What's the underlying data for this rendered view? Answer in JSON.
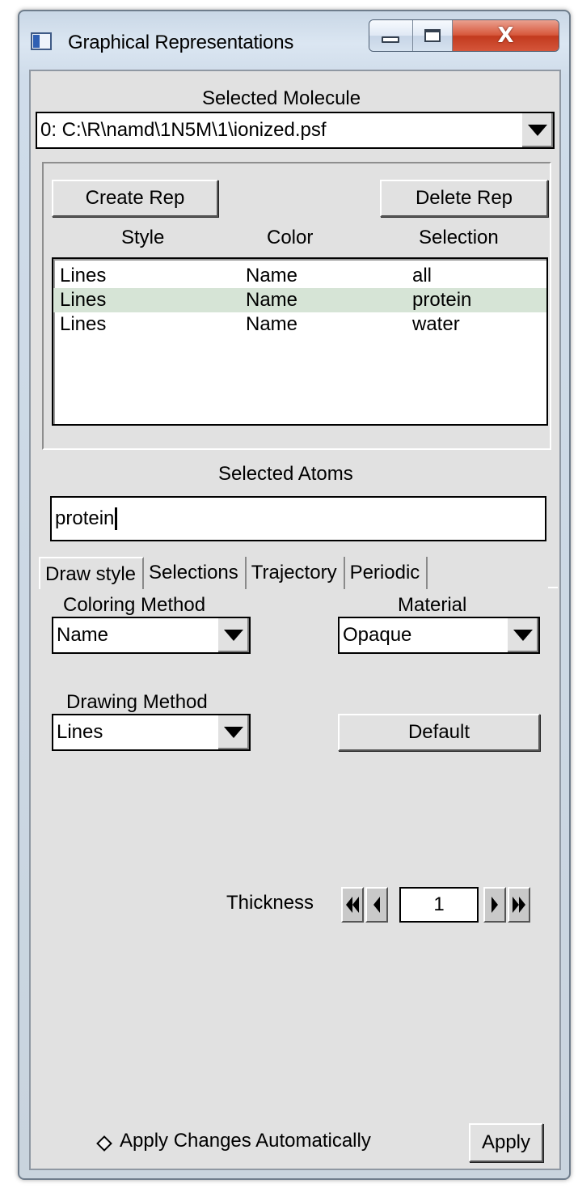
{
  "window": {
    "title": "Graphical Representations",
    "close_glyph": "X"
  },
  "molecule": {
    "label": "Selected Molecule",
    "value": "0: C:\\R\\namd\\1N5M\\1\\ionized.psf"
  },
  "reps": {
    "create_label": "Create Rep",
    "delete_label": "Delete Rep",
    "headers": {
      "style": "Style",
      "color": "Color",
      "selection": "Selection"
    },
    "rows": [
      {
        "style": "Lines",
        "color": "Name",
        "selection": "all",
        "selected": false
      },
      {
        "style": "Lines",
        "color": "Name",
        "selection": "protein",
        "selected": true
      },
      {
        "style": "Lines",
        "color": "Name",
        "selection": "water",
        "selected": false
      }
    ],
    "selected_row_color": "#d6e4d6"
  },
  "atoms": {
    "label": "Selected Atoms",
    "value": "protein"
  },
  "tabs": [
    {
      "label": "Draw style",
      "active": true
    },
    {
      "label": "Selections",
      "active": false
    },
    {
      "label": "Trajectory",
      "active": false
    },
    {
      "label": "Periodic",
      "active": false
    }
  ],
  "draw_style": {
    "coloring_label": "Coloring Method",
    "coloring_value": "Name",
    "material_label": "Material",
    "material_value": "Opaque",
    "drawing_label": "Drawing Method",
    "drawing_value": "Lines",
    "default_label": "Default",
    "thickness_label": "Thickness",
    "thickness_value": "1"
  },
  "footer": {
    "auto_apply_label": "Apply Changes Automatically",
    "apply_label": "Apply"
  },
  "icons": [
    "window-app-icon",
    "minimize-icon",
    "maximize-icon",
    "close-icon",
    "dropdown-arrow-icon",
    "spin-fast-left-icon",
    "spin-left-icon",
    "spin-right-icon",
    "spin-fast-right-icon",
    "radio-diamond-icon"
  ]
}
